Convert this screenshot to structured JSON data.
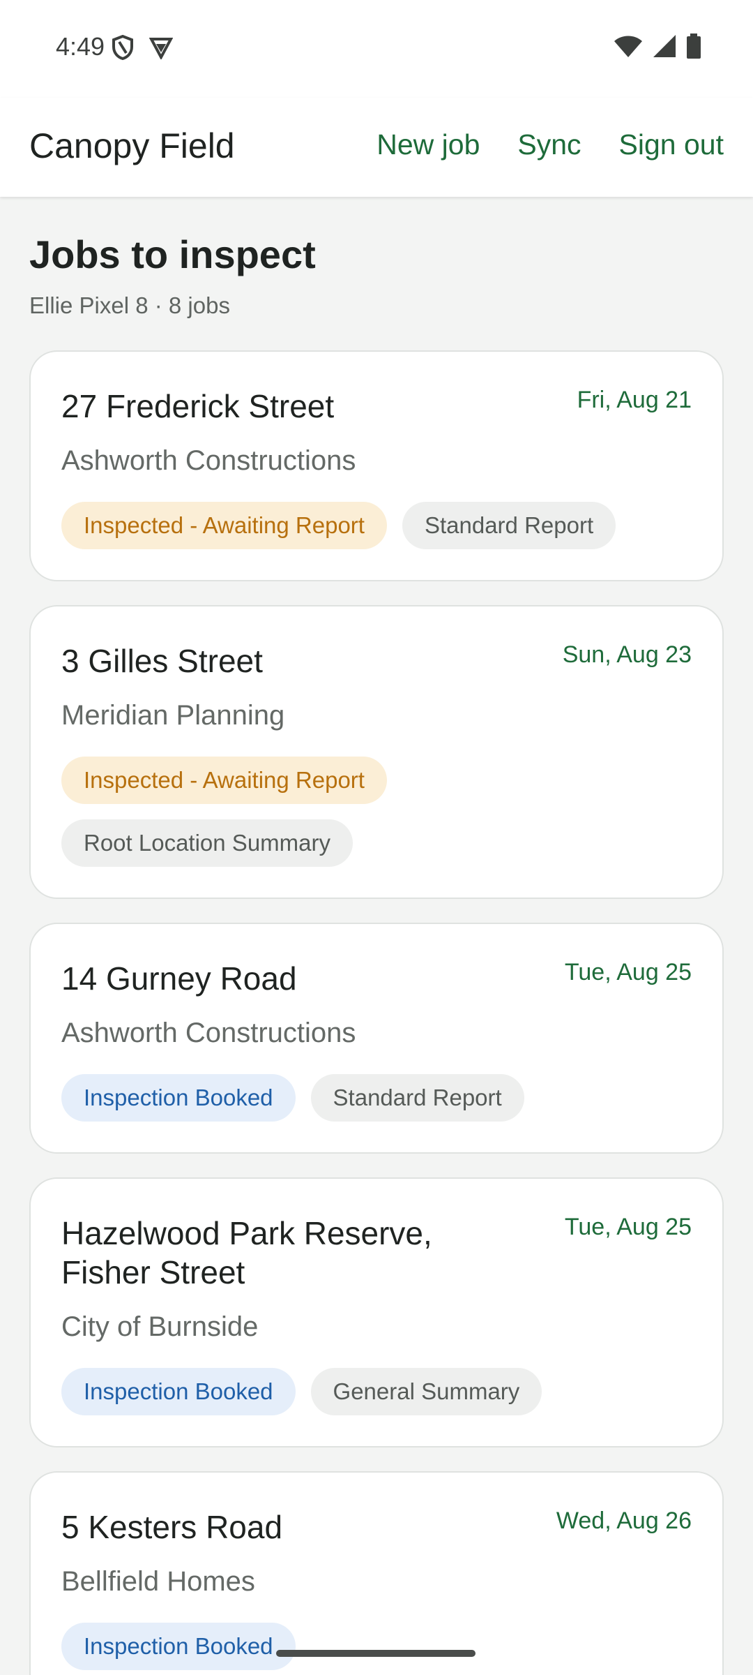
{
  "status_bar": {
    "time": "4:49",
    "left_icons": [
      "shield-icon",
      "vpn-icon"
    ],
    "right_icons": [
      "wifi-icon",
      "signal-icon",
      "battery-icon"
    ]
  },
  "app_bar": {
    "title": "Canopy Field",
    "actions": [
      "New job",
      "Sync",
      "Sign out"
    ]
  },
  "page": {
    "title": "Jobs to inspect",
    "subtitle": "Ellie Pixel 8 · 8 jobs"
  },
  "jobs": [
    {
      "address": "27 Frederick Street",
      "date": "Fri, Aug 21",
      "client": "Ashworth Constructions",
      "status": "Inspected - Awaiting Report",
      "status_kind": "awaiting",
      "report_type": "Standard Report"
    },
    {
      "address": "3 Gilles Street",
      "date": "Sun, Aug 23",
      "client": "Meridian Planning",
      "status": "Inspected - Awaiting Report",
      "status_kind": "awaiting",
      "report_type": "Root Location Summary"
    },
    {
      "address": "14 Gurney Road",
      "date": "Tue, Aug 25",
      "client": "Ashworth Constructions",
      "status": "Inspection Booked",
      "status_kind": "booked",
      "report_type": "Standard Report"
    },
    {
      "address": "Hazelwood Park Reserve, Fisher Street",
      "date": "Tue, Aug 25",
      "client": "City of Burnside",
      "status": "Inspection Booked",
      "status_kind": "booked",
      "report_type": "General Summary"
    },
    {
      "address": "5 Kesters Road",
      "date": "Wed, Aug 26",
      "client": "Bellfield Homes",
      "status": "Inspection Booked",
      "status_kind": "booked",
      "report_type": ""
    }
  ],
  "colors": {
    "accent": "#1e6b3a",
    "awaiting_bg": "#fbeed6",
    "awaiting_text": "#b7700e",
    "booked_bg": "#e5eefa",
    "booked_text": "#1f5fa8"
  }
}
